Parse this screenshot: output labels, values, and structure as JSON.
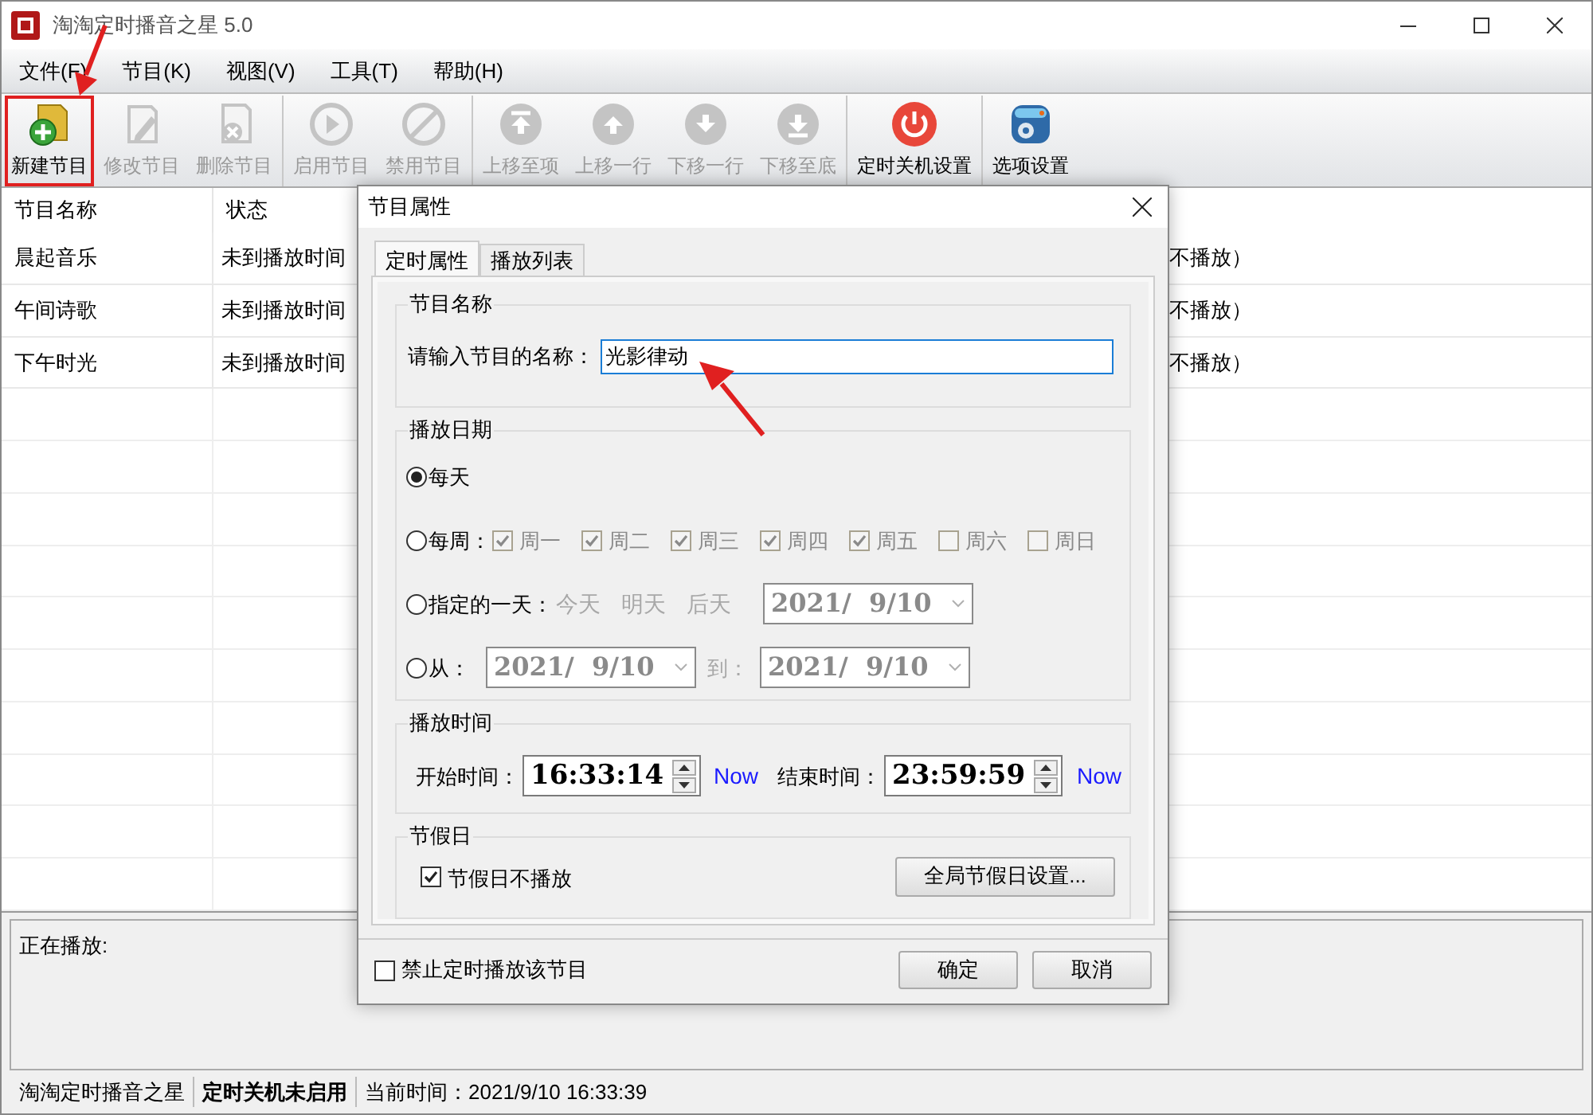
{
  "window": {
    "title": "淘淘定时播音之星 5.0"
  },
  "menu": [
    "文件(F)",
    "节目(K)",
    "视图(V)",
    "工具(T)",
    "帮助(H)"
  ],
  "toolbar": [
    [
      {
        "label": "新建节目",
        "kind": "new",
        "disabled": false,
        "highlighted": true
      },
      {
        "label": "修改节目",
        "kind": "edit",
        "disabled": true,
        "highlighted": false
      },
      {
        "label": "删除节目",
        "kind": "delete",
        "disabled": true,
        "highlighted": false
      }
    ],
    [
      {
        "label": "启用节目",
        "kind": "play",
        "disabled": true,
        "highlighted": false
      },
      {
        "label": "禁用节目",
        "kind": "ban",
        "disabled": true,
        "highlighted": false
      }
    ],
    [
      {
        "label": "上移至项",
        "kind": "top",
        "disabled": true,
        "highlighted": false
      },
      {
        "label": "上移一行",
        "kind": "up",
        "disabled": true,
        "highlighted": false
      },
      {
        "label": "下移一行",
        "kind": "down",
        "disabled": true,
        "highlighted": false
      },
      {
        "label": "下移至底",
        "kind": "bottom",
        "disabled": true,
        "highlighted": false
      }
    ],
    [
      {
        "label": "定时关机设置",
        "kind": "power",
        "disabled": false,
        "highlighted": false
      }
    ],
    [
      {
        "label": "选项设置",
        "kind": "options",
        "disabled": false,
        "highlighted": false
      }
    ]
  ],
  "table": {
    "columns": [
      "节目名称",
      "状态"
    ],
    "rows": [
      {
        "name": "晨起音乐",
        "status": "未到播放时间",
        "column_3": "不播放）"
      },
      {
        "name": "午间诗歌",
        "status": "未到播放时间",
        "column_3": "不播放）"
      },
      {
        "name": "下午时光",
        "status": "未到播放时间",
        "column_3": "不播放）"
      }
    ]
  },
  "now_playing": {
    "label": "正在播放:"
  },
  "status_bar": [
    {
      "text": "淘淘定时播音之星",
      "bold": false
    },
    {
      "text": "定时关机未启用",
      "bold": true
    },
    {
      "text": "当前时间：2021/9/10 16:33:39",
      "bold": false
    }
  ],
  "dialog": {
    "title": "节目属性",
    "tabs": [
      {
        "label": "定时属性",
        "selected": true
      },
      {
        "label": "播放列表",
        "selected": false
      }
    ],
    "name_group": {
      "title": "节目名称",
      "label": "请输入节目的名称：",
      "value": "光影律动"
    },
    "date_group": {
      "title": "播放日期",
      "options": [
        {
          "kind": "daily",
          "label": "每天",
          "selected": true
        },
        {
          "kind": "weekly",
          "label": "每周：",
          "selected": false,
          "days": [
            {
              "label": "周一",
              "checked": true
            },
            {
              "label": "周二",
              "checked": true
            },
            {
              "label": "周三",
              "checked": true
            },
            {
              "label": "周四",
              "checked": true
            },
            {
              "label": "周五",
              "checked": true
            },
            {
              "label": "周六",
              "checked": false
            },
            {
              "label": "周日",
              "checked": false
            }
          ]
        },
        {
          "kind": "single",
          "label": "指定的一天：",
          "selected": false,
          "shortcuts": [
            "今天",
            "明天",
            "后天"
          ],
          "date": "2021/  9/10"
        },
        {
          "kind": "range",
          "label": "从：",
          "selected": false,
          "from": "2021/  9/10",
          "to_label": "到：",
          "to": "2021/  9/10"
        }
      ]
    },
    "time_group": {
      "title": "播放时间",
      "start_label": "开始时间：",
      "start": "16:33:14",
      "start_now": "Now",
      "end_label": "结束时间：",
      "end": "23:59:59",
      "end_now": "Now"
    },
    "holiday_group": {
      "title": "节假日",
      "checkbox": {
        "label": "节假日不播放",
        "checked": true
      },
      "button": "全局节假日设置..."
    },
    "disable_checkbox": {
      "label": "禁止定时播放该节目",
      "checked": false
    },
    "buttons": [
      "确定",
      "取消"
    ]
  }
}
